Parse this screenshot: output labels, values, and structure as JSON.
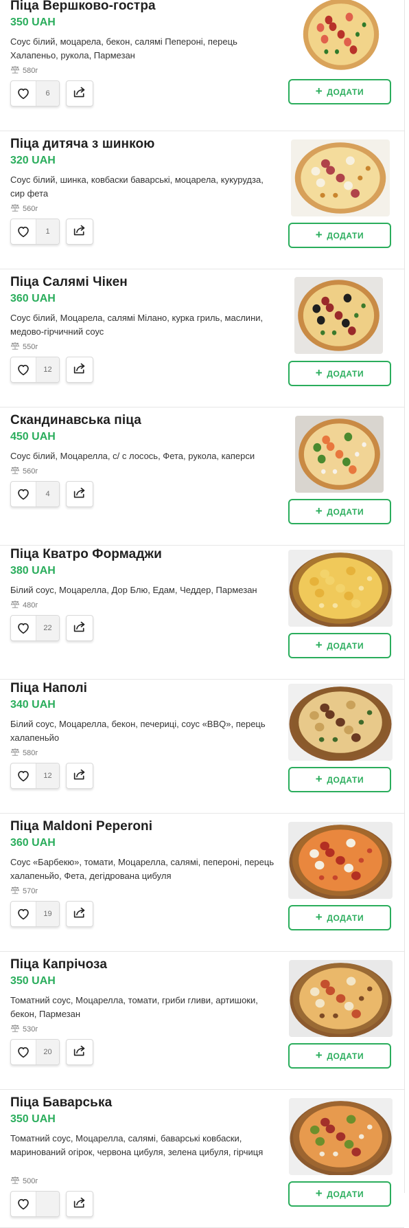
{
  "add_label": "ДОДАТИ",
  "brand_color": "#2aad5c",
  "icons": {
    "like": "heart-icon",
    "share": "share-icon",
    "weight": "scales-icon",
    "add": "plus-icon"
  },
  "products": [
    {
      "name": "Піца Вершково-гостра",
      "price": "350 UAH",
      "description": "Соус білий, моцарела, бекон, салямі Пепероні, перець Халапеньо, рукола, Пармезан",
      "weight": "580г",
      "likes": "6"
    },
    {
      "name": "Піца дитяча з шинкою",
      "price": "320 UAH",
      "description": "Соус білий,  шинка, ковбаски баварські, моцарела, кукурудза, сир фета",
      "weight": "560г",
      "likes": "1"
    },
    {
      "name": "Піца Салямі Чікен",
      "price": "360 UAH",
      "description": "Соус білий, Моцарела, салямі Мілано, курка гриль, маслини, медово-гірчичний соус",
      "weight": "550г",
      "likes": "12"
    },
    {
      "name": "Скандинавська піца",
      "price": "450 UAH",
      "description": "Соус білий, Моцарелла, с/ с лосось, Фета, рукола, каперси",
      "weight": "560г",
      "likes": "4"
    },
    {
      "name": "Піца Кватро Формаджи",
      "price": "380 UAH",
      "description": "Білий соус, Моцарелла, Дор Блю, Едам, Чеддер, Пармезан",
      "weight": "480г",
      "likes": "22"
    },
    {
      "name": "Піца Наполі",
      "price": "340 UAH",
      "description": "Білий соус, Моцарелла, бекон, печериці, соус «BBQ», перець халапеньйо",
      "weight": "580г",
      "likes": "12"
    },
    {
      "name": "Піца Maldoni Peperoni",
      "price": "360 UAH",
      "description": "Соус «Барбекю», томати, Моцарелла, салямі, пепероні, перець халапеньйо, Фета, дегідрована цибуля",
      "weight": "570г",
      "likes": "19"
    },
    {
      "name": "Піца Капрічоза",
      "price": "350 UAH",
      "description": "Томатний соус, Моцарелла, томати, гриби гливи, артишоки, бекон, Пармезан",
      "weight": "530г",
      "likes": "20"
    },
    {
      "name": "Піца Баварська",
      "price": "350 UAH",
      "description": "Томатний соус, Моцарелла, салямі, баварські ковбаски, маринований огірок, червона цибуля, зелена цибуля, гірчиця",
      "weight": "500г",
      "likes": ""
    }
  ]
}
